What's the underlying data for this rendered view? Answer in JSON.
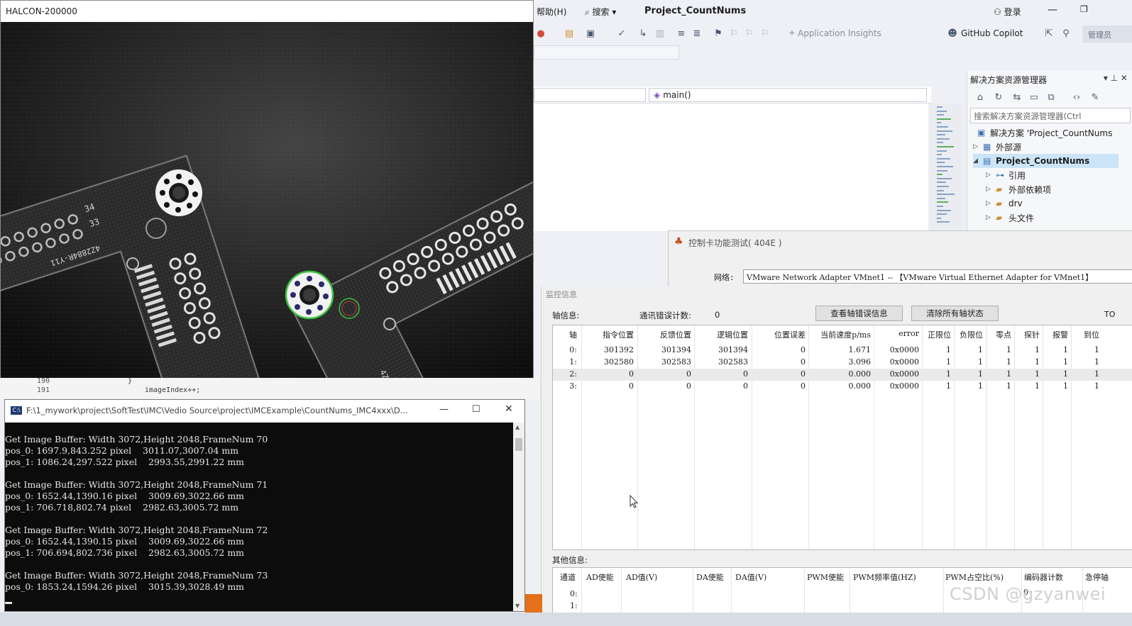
{
  "vs": {
    "menu": {
      "help": "帮助(H)",
      "search": "搜索",
      "search_arrow": "▾",
      "title": "Project_CountNums",
      "login": "登录"
    },
    "toolbar": {
      "app_insights": "Application Insights",
      "copilot": "GitHub Copilot",
      "admin": "管理员"
    },
    "editor": {
      "function_combo": "main()"
    },
    "solution_explorer": {
      "title": "解决方案资源管理器",
      "search_placeholder": "搜索解决方案资源管理器(Ctrl",
      "items": [
        {
          "label": "解决方案 'Project_CountNums"
        },
        {
          "label": "外部源"
        },
        {
          "label": "Project_CountNums"
        },
        {
          "label": "引用"
        },
        {
          "label": "外部依赖项"
        },
        {
          "label": "drv"
        },
        {
          "label": "头文件"
        }
      ]
    }
  },
  "halcon": {
    "title": "HALCON-200000",
    "board_text": [
      "34",
      "33",
      "4Z2884R-Y11",
      "4Z2884R-Y1",
      "E3"
    ]
  },
  "code_strip": {
    "lines": [
      {
        "no": "190",
        "code": "}"
      },
      {
        "no": "191",
        "code": "imageIndex++;"
      }
    ]
  },
  "console": {
    "title": "F:\\1_mywork\\project\\SoftTest\\IMC\\Vedio Source\\project\\IMCExample\\CountNums_IMC4xxx\\D...",
    "icon_label": "C:\\",
    "lines": [
      "Get Image Buffer: Width 3072,Height 2048,FrameNum 70",
      "pos_0: 1697.9,843.252 pixel    3011.07,3007.04 mm",
      "pos_1: 1086.24,297.522 pixel    2993.55,2991.22 mm",
      "",
      "Get Image Buffer: Width 3072,Height 2048,FrameNum 71",
      "pos_0: 1652.44,1390.16 pixel    3009.69,3022.66 mm",
      "pos_1: 706.718,802.74 pixel    2982.63,3005.72 mm",
      "",
      "Get Image Buffer: Width 3072,Height 2048,FrameNum 72",
      "pos_0: 1652.44,1390.15 pixel    3009.69,3022.66 mm",
      "pos_1: 706.694,802.736 pixel    2982.63,3005.72 mm",
      "",
      "Get Image Buffer: Width 3072,Height 2048,FrameNum 73",
      "pos_0: 1853.24,1594.26 pixel    3015.39,3028.49 mm"
    ]
  },
  "control": {
    "title": "控制卡功能测试( 404E )",
    "network_label": "网络:",
    "network_value": "VMware Network Adapter VMnet1 -- 【VMware Virtual Ethernet Adapter for VMnet1】",
    "monitor_title": "监控信息",
    "axis_info_label": "轴信息:",
    "comm_error_label": "通讯错误计数:",
    "comm_error_count": "0",
    "btn_view_errors": "查看轴错误信息",
    "btn_clear_status": "清除所有轴状态",
    "to_label": "TO",
    "axis_columns": [
      "轴",
      "指令位置",
      "反馈位置",
      "逻辑位置",
      "位置误差",
      "当前速度p/ms",
      "error",
      "正限位",
      "负限位",
      "零点",
      "探针",
      "报警",
      "到位"
    ],
    "axis_rows": [
      [
        "0:",
        "301392",
        "301394",
        "301394",
        "0",
        "1.671",
        "0x0000",
        "1",
        "1",
        "1",
        "1",
        "1",
        "1"
      ],
      [
        "1:",
        "302580",
        "302583",
        "302583",
        "0",
        "3.096",
        "0x0000",
        "1",
        "1",
        "1",
        "1",
        "1",
        "1"
      ],
      [
        "2:",
        "0",
        "0",
        "0",
        "0",
        "0.000",
        "0x0000",
        "1",
        "1",
        "1",
        "1",
        "1",
        "1"
      ],
      [
        "3:",
        "0",
        "0",
        "0",
        "0",
        "0.000",
        "0x0000",
        "1",
        "1",
        "1",
        "1",
        "1",
        "1"
      ]
    ],
    "other_info_label": "其他信息:",
    "other_columns": [
      "通道",
      "AD使能",
      "AD值(V)",
      "DA使能",
      "DA值(V)",
      "PWM使能",
      "PWM频率值(HZ)",
      "PWM占空比(%)",
      "编码器计数",
      "急停轴"
    ],
    "other_rows": [
      [
        "0:",
        "0"
      ],
      [
        "1:",
        ""
      ]
    ]
  },
  "watermark": "CSDN @gzyanwei"
}
